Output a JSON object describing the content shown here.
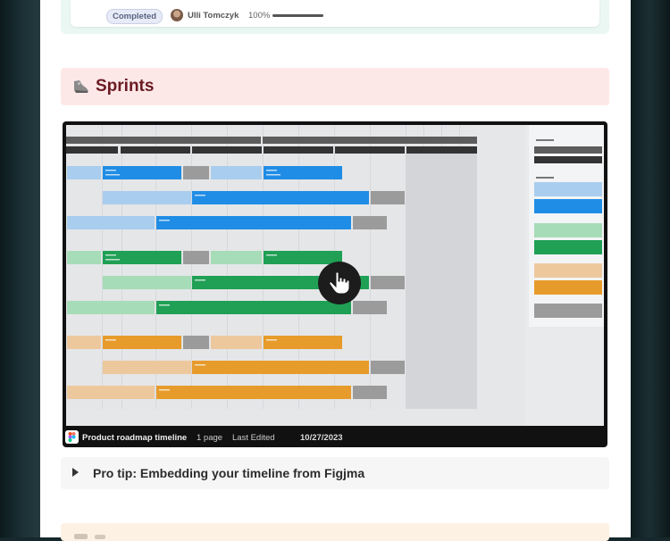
{
  "previous_card": {
    "status": "Completed",
    "owner": "Ulli Tomczyk",
    "progress_label": "100%",
    "progress": 1.0
  },
  "section": {
    "icon": "running-shoe-icon",
    "title": "Sprints"
  },
  "embed": {
    "file_name": "Product roadmap timeline",
    "pages": "1 page",
    "edited_label": "Last Edited",
    "edited_date": "10/27/2023",
    "app_icon": "figma-icon",
    "cursor_icon": "hand-pointer-icon"
  },
  "toggle": {
    "text": "Pro tip: Embedding your timeline from Figjma"
  },
  "colors": {
    "blue": "#1f8de6",
    "blue_light": "#a9cdee",
    "green": "#1fa055",
    "green_light": "#a6dcb7",
    "orange": "#e79b2a",
    "orange_light": "#edc89d",
    "grey_bar": "#9b9b9b",
    "sprints_bg": "#fde8e8",
    "sprints_text": "#6b1a22"
  }
}
